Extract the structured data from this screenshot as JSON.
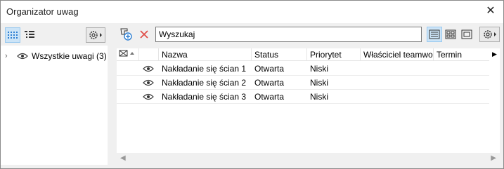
{
  "window": {
    "title": "Organizator uwag"
  },
  "left_pane": {
    "tree": [
      {
        "label": "Wszystkie uwagi (3)"
      }
    ]
  },
  "toolbar": {
    "search_value": "Wyszukaj"
  },
  "table": {
    "columns": [
      "Nazwa",
      "Status",
      "Priorytet",
      "Właściciel teamwor",
      "Termin"
    ],
    "rows": [
      {
        "name": "Nakładanie się ścian 1",
        "status": "Otwarta",
        "priority": "Niski"
      },
      {
        "name": "Nakładanie się ścian 2",
        "status": "Otwarta",
        "priority": "Niski"
      },
      {
        "name": "Nakładanie się ścian 3",
        "status": "Otwarta",
        "priority": "Niski"
      }
    ]
  },
  "colors": {
    "active_button_bg": "#cce4f7",
    "active_button_border": "#99c9ef",
    "delete_red": "#e0504a",
    "add_icon_blue": "#2d7fd3"
  },
  "icons": [
    "grid-view-icon",
    "tree-view-icon",
    "settings-gear-icon",
    "add-note-icon",
    "delete-icon",
    "list-view-icon",
    "thumbnail-view-icon",
    "single-view-icon",
    "eye-icon",
    "chevron-right-icon",
    "close-icon"
  ]
}
